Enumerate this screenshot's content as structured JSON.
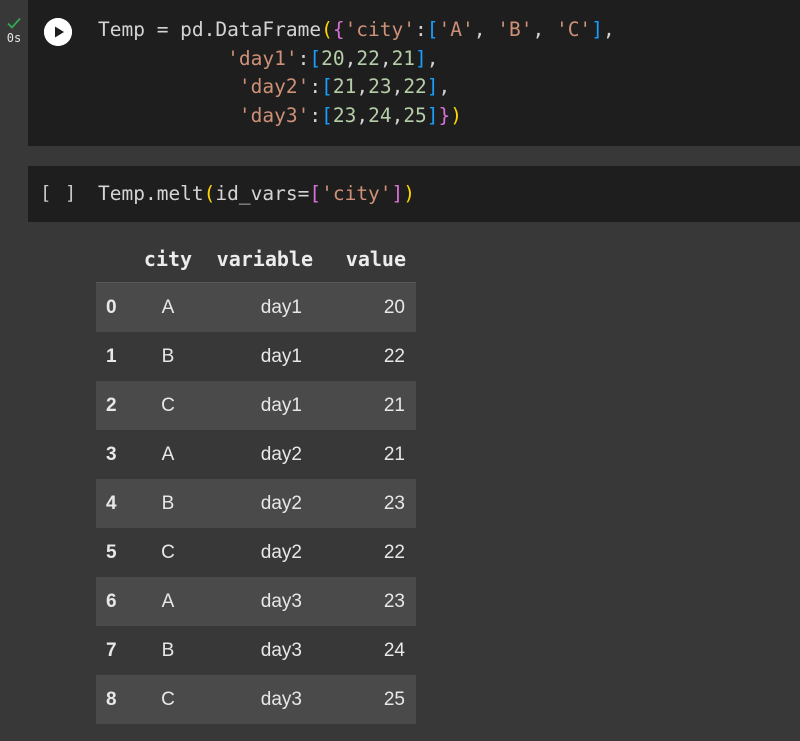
{
  "gutter": {
    "exec_time": "0s"
  },
  "cell1": {
    "code_lines": [
      "Temp = pd.DataFrame({'city':['A', 'B', 'C'],",
      "           'day1':[20,22,21],",
      "            'day2':[21,23,22],",
      "            'day3':[23,24,25]})"
    ]
  },
  "cell2": {
    "exec_count": "[ ]",
    "code": "Temp.melt(id_vars=['city'])"
  },
  "output": {
    "columns": [
      "city",
      "variable",
      "value"
    ],
    "rows": [
      {
        "index": "0",
        "city": "A",
        "variable": "day1",
        "value": "20"
      },
      {
        "index": "1",
        "city": "B",
        "variable": "day1",
        "value": "22"
      },
      {
        "index": "2",
        "city": "C",
        "variable": "day1",
        "value": "21"
      },
      {
        "index": "3",
        "city": "A",
        "variable": "day2",
        "value": "21"
      },
      {
        "index": "4",
        "city": "B",
        "variable": "day2",
        "value": "23"
      },
      {
        "index": "5",
        "city": "C",
        "variable": "day2",
        "value": "22"
      },
      {
        "index": "6",
        "city": "A",
        "variable": "day3",
        "value": "23"
      },
      {
        "index": "7",
        "city": "B",
        "variable": "day3",
        "value": "24"
      },
      {
        "index": "8",
        "city": "C",
        "variable": "day3",
        "value": "25"
      }
    ]
  },
  "colors": {
    "background": "#383838",
    "cell_background": "#1e1e1e",
    "success": "#34a853",
    "string": "#ce9178",
    "number": "#b5cea8"
  },
  "icons": [
    "check-icon",
    "play-icon"
  ]
}
